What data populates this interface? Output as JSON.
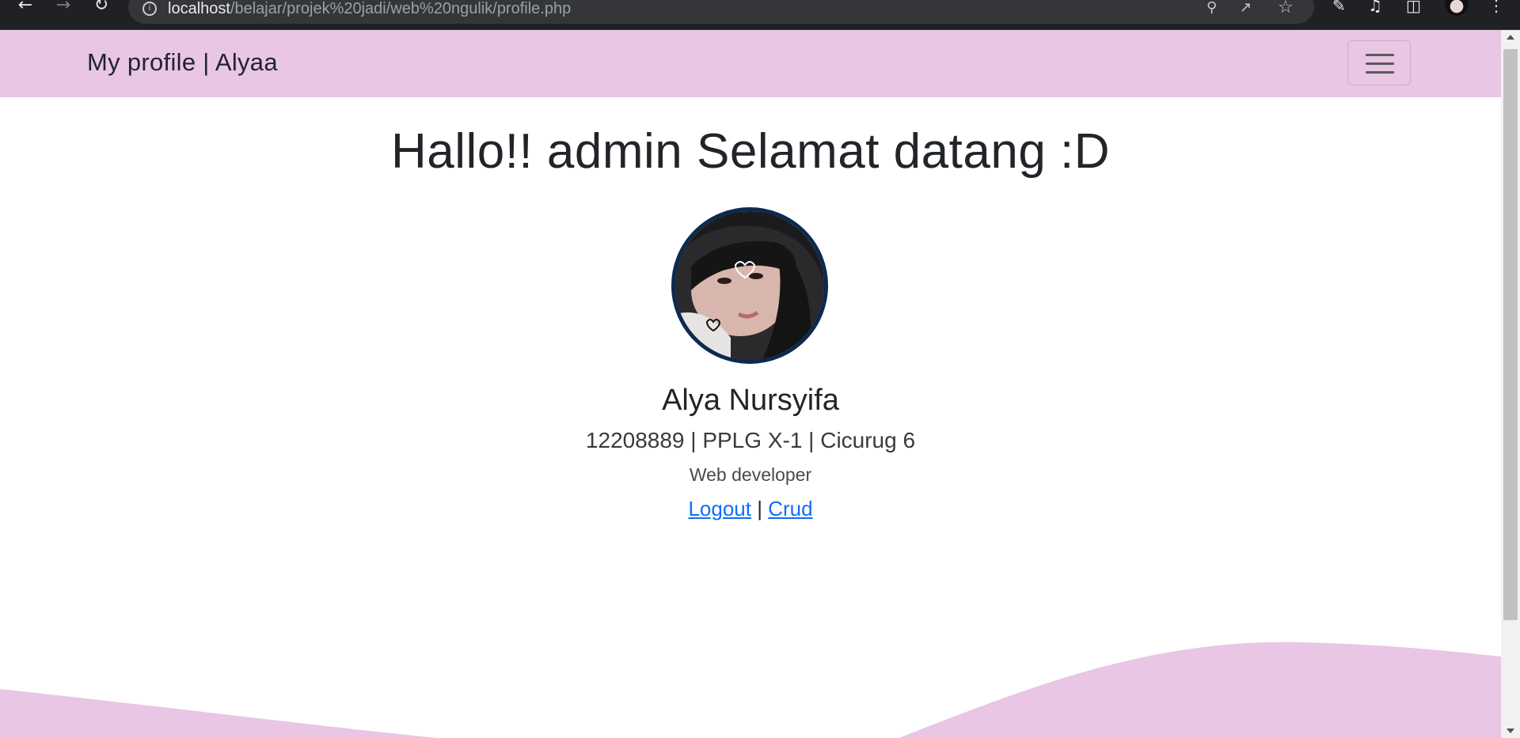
{
  "browser": {
    "url_host": "localhost",
    "url_path": "/belajar/projek%20jadi/web%20ngulik/profile.php"
  },
  "navbar": {
    "brand": "My profile | Alyaa",
    "background": "#e8c6e4"
  },
  "page": {
    "greeting": "Hallo!! admin Selamat datang :D",
    "profile": {
      "name": "Alya Nursyifa",
      "info": "12208889 | PPLG X-1 | Cicurug 6",
      "role": "Web developer"
    },
    "links": {
      "logout": "Logout",
      "separator": "|",
      "crud": "Crud"
    }
  },
  "colors": {
    "accent_pink": "#e8c6e4",
    "link_blue": "#0d6efd",
    "avatar_border": "#0c2a4d"
  }
}
